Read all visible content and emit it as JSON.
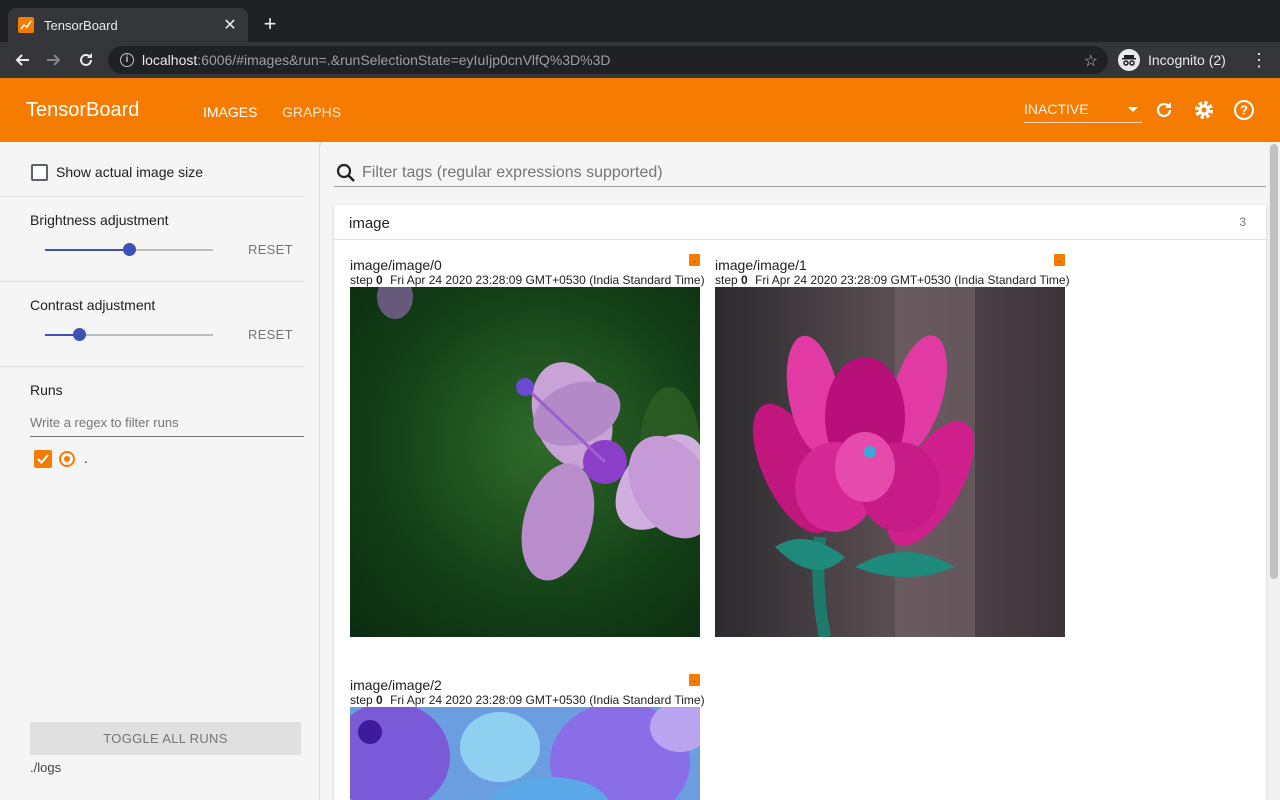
{
  "browser": {
    "tab_title": "TensorBoard",
    "url_host": "localhost",
    "url_rest": ":6006/#images&run=.&runSelectionState=eyIuIjp0cnVlfQ%3D%3D",
    "profile_label": "Incognito (2)",
    "accent": "#f57c00"
  },
  "header": {
    "title": "TensorBoard",
    "tabs": [
      {
        "label": "IMAGES",
        "active": true
      },
      {
        "label": "GRAPHS",
        "active": false
      }
    ],
    "status_select": "INACTIVE",
    "icons": [
      "refresh-icon",
      "settings-icon",
      "help-icon"
    ]
  },
  "sidebar": {
    "show_actual_size_label": "Show actual image size",
    "brightness": {
      "label": "Brightness adjustment",
      "value": 0.5,
      "reset": "RESET"
    },
    "contrast": {
      "label": "Contrast adjustment",
      "value": 0.2,
      "reset": "RESET"
    },
    "runs_label": "Runs",
    "runs_filter_placeholder": "Write a regex to filter runs",
    "runs": [
      {
        "name": "."
      }
    ],
    "toggle_all": "TOGGLE ALL RUNS",
    "logdir": "./logs"
  },
  "main": {
    "filter_placeholder": "Filter tags (regular expressions supported)",
    "card": {
      "title": "image",
      "count": "3",
      "images": [
        {
          "tag": "image/image/0",
          "step_label": "step",
          "step": "0",
          "time": "Fri Apr 24 2020 23:28:09 GMT+0530 (India Standard Time)",
          "run_badge": "."
        },
        {
          "tag": "image/image/1",
          "step_label": "step",
          "step": "0",
          "time": "Fri Apr 24 2020 23:28:09 GMT+0530 (India Standard Time)",
          "run_badge": "."
        },
        {
          "tag": "image/image/2",
          "step_label": "step",
          "step": "0",
          "time": "Fri Apr 24 2020 23:28:09 GMT+0530 (India Standard Time)",
          "run_badge": "."
        }
      ]
    }
  }
}
